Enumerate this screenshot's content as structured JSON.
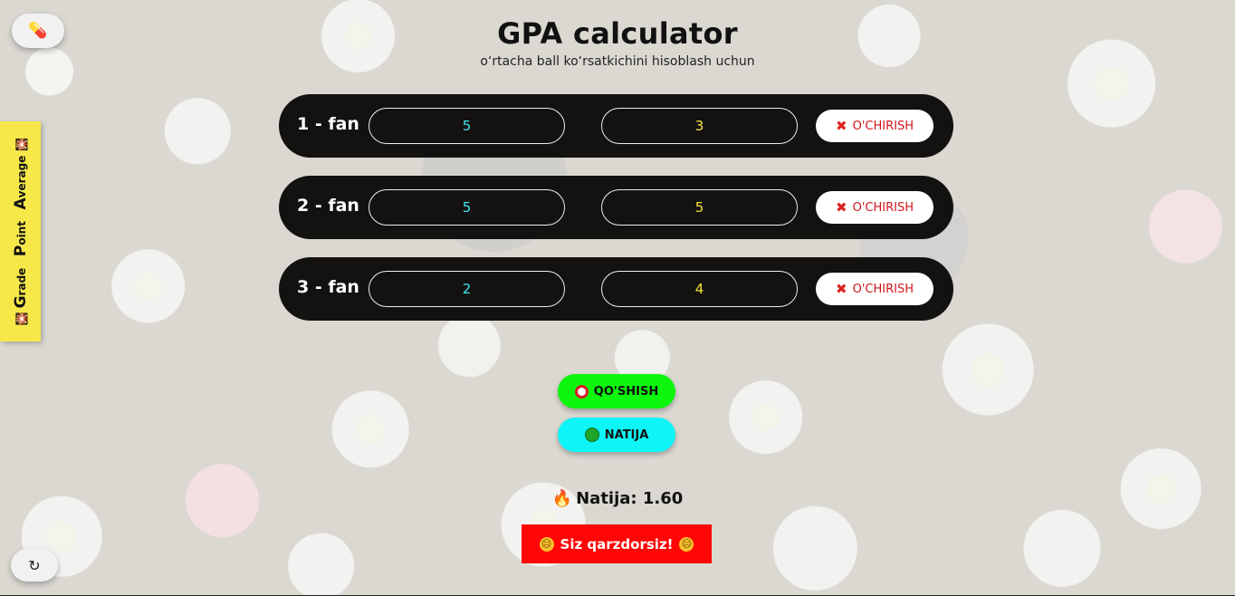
{
  "header": {
    "title": "GPA calculator",
    "subtitle": "oʻrtacha ball koʻrsatkichini hisoblash uchun"
  },
  "top_button": {
    "icon": "pill-icon",
    "glyph": "💊"
  },
  "bottom_button": {
    "icon": "refresh-icon",
    "glyph": "↻"
  },
  "side_tab": {
    "emoji": "🎇",
    "words": [
      {
        "cap": "G",
        "rest": "rade"
      },
      {
        "cap": "P",
        "rest": "oint"
      },
      {
        "cap": "A",
        "rest": "verage"
      }
    ]
  },
  "rows": [
    {
      "label": "1 - fan",
      "grade": "5",
      "credit": "3",
      "delete_label": "O'CHIRISH"
    },
    {
      "label": "2 - fan",
      "grade": "5",
      "credit": "5",
      "delete_label": "O'CHIRISH"
    },
    {
      "label": "3 - fan",
      "grade": "2",
      "credit": "4",
      "delete_label": "O'CHIRISH"
    }
  ],
  "actions": {
    "add_label": "QO'SHISH",
    "result_label": "NATIJA"
  },
  "result": {
    "text": "Natija: 1.60"
  },
  "status": {
    "text": "Siz qarzdorsiz!"
  },
  "colors": {
    "row_bg": "#141111",
    "grade_text": "#3ee7ef",
    "credit_text": "#f6e637",
    "delete_text": "#d0141a",
    "add_bg": "#0cf70c",
    "result_bg": "#0ff5f7",
    "debt_bg": "#ff0505",
    "side_tab_bg": "#f7e84a"
  }
}
